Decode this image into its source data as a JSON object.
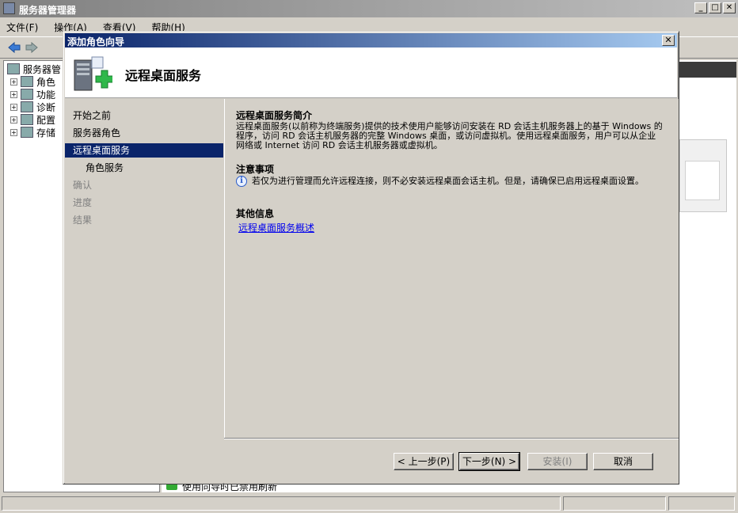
{
  "main_window": {
    "title": "服务器管理器",
    "menu": [
      "文件(F)",
      "操作(A)",
      "查看(V)",
      "帮助(H)"
    ],
    "controls": {
      "minimize": "_",
      "maximize": "□",
      "close": "✕"
    }
  },
  "tree": {
    "root": "服务器管",
    "items": [
      "角色",
      "功能",
      "诊断",
      "配置",
      "存储"
    ]
  },
  "bottom_strip": {
    "text": "使用向导时已禁用刷新"
  },
  "dialog": {
    "title": "添加角色向导",
    "close": "✕",
    "header_title": "远程桌面服务",
    "nav": [
      {
        "label": "开始之前",
        "state": "normal"
      },
      {
        "label": "服务器角色",
        "state": "normal"
      },
      {
        "label": "远程桌面服务",
        "state": "selected"
      },
      {
        "label": "角色服务",
        "state": "sub"
      },
      {
        "label": "确认",
        "state": "disabled"
      },
      {
        "label": "进度",
        "state": "disabled"
      },
      {
        "label": "结果",
        "state": "disabled"
      }
    ],
    "intro_title": "远程桌面服务简介",
    "intro_text": "远程桌面服务(以前称为终端服务)提供的技术使用户能够访问安装在 RD 会话主机服务器上的基于 Windows 的程序，访问 RD 会话主机服务器的完整 Windows 桌面，或访问虚拟机。使用远程桌面服务，用户可以从企业网络或 Internet 访问 RD 会话主机服务器或虚拟机。",
    "notes_title": "注意事项",
    "note_text": "若仅为进行管理而允许远程连接，则不必安装远程桌面会话主机。但是，请确保已启用远程桌面设置。",
    "more_title": "其他信息",
    "link_text": "远程桌面服务概述",
    "buttons": {
      "prev": "< 上一步(P)",
      "next": "下一步(N) >",
      "install": "安装(I)",
      "cancel": "取消"
    }
  }
}
